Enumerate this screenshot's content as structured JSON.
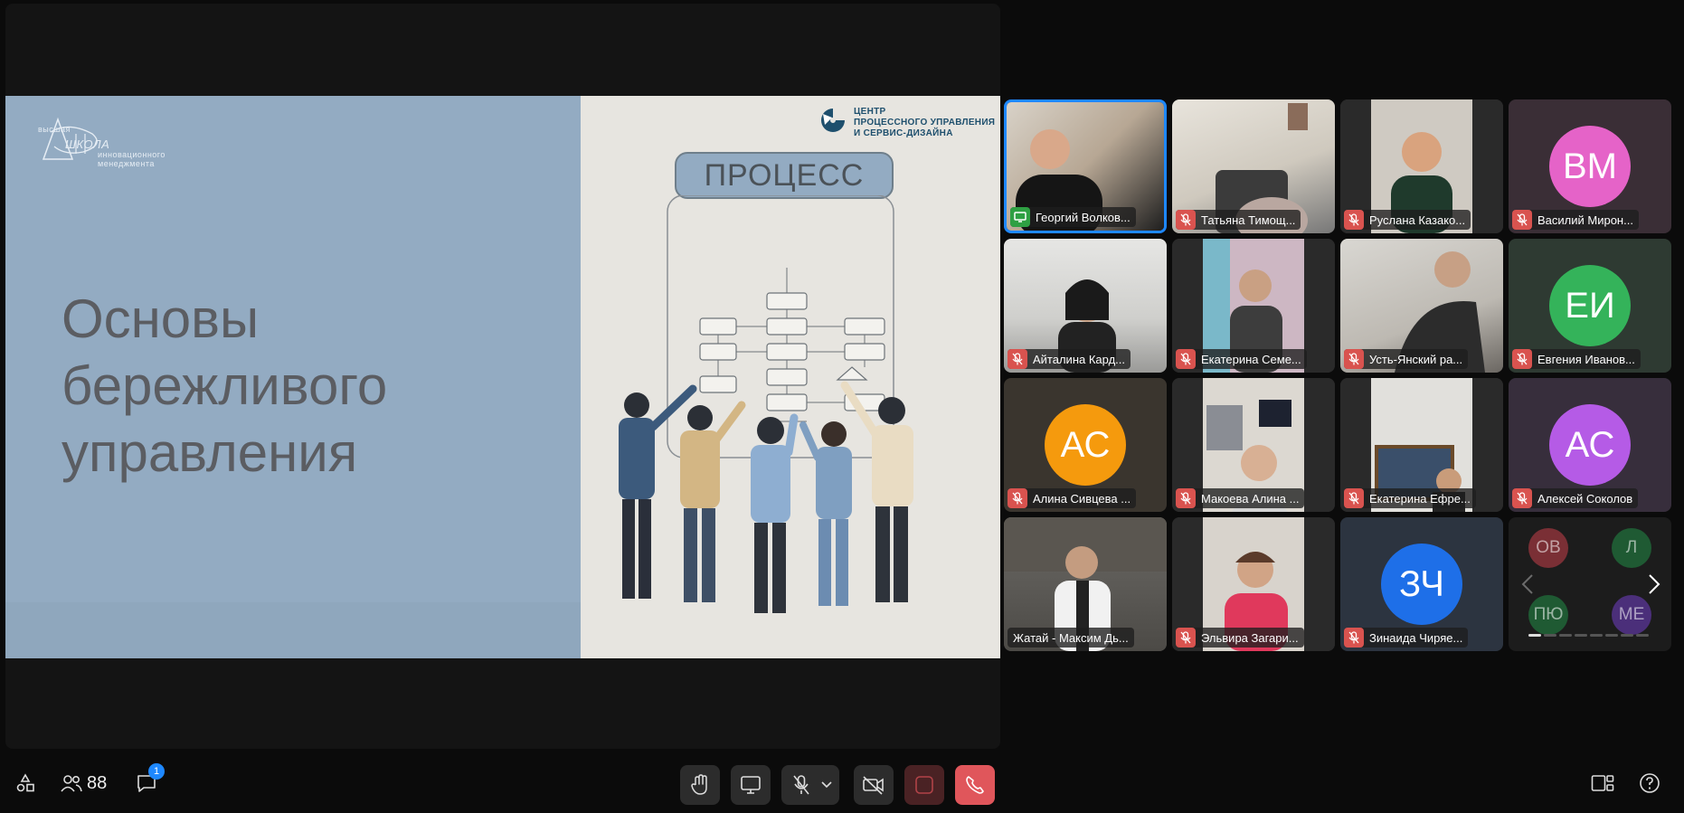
{
  "slide": {
    "title_line1": "Основы",
    "title_line2": "бережливого",
    "title_line3": "управления",
    "logo_left": {
      "line1": "высшая",
      "line2": "ШКОЛА",
      "line3": "инновационного",
      "line4": "менеджмента"
    },
    "logo_right": {
      "line1": "ЦЕНТР",
      "line2": "ПРОЦЕССНОГО УПРАВЛЕНИЯ",
      "line3": "И СЕРВИС-ДИЗАЙНА"
    },
    "process_label": "ПРОЦЕСС"
  },
  "participants": [
    {
      "name": "Георгий Волков...",
      "type": "video",
      "mic": "share",
      "active": true
    },
    {
      "name": "Татьяна Тимощ...",
      "type": "video",
      "mic": "muted"
    },
    {
      "name": "Руслана Казако...",
      "type": "video",
      "mic": "muted"
    },
    {
      "name": "Василий Мирон...",
      "type": "avatar",
      "initials": "ВМ",
      "color": "#e563c8",
      "mic": "muted"
    },
    {
      "name": "Айталина Кард...",
      "type": "video",
      "mic": "muted"
    },
    {
      "name": "Екатерина Семе...",
      "type": "video",
      "mic": "muted"
    },
    {
      "name": "Усть-Янский ра...",
      "type": "video",
      "mic": "muted"
    },
    {
      "name": "Евгения Иванов...",
      "type": "avatar",
      "initials": "ЕИ",
      "color": "#34b35a",
      "mic": "muted"
    },
    {
      "name": "Алина Сивцева ...",
      "type": "avatar",
      "initials": "АС",
      "color": "#f59a0d",
      "mic": "muted"
    },
    {
      "name": "Макоева Алина ...",
      "type": "video",
      "mic": "muted"
    },
    {
      "name": "Екатерина Ефре...",
      "type": "video",
      "mic": "muted"
    },
    {
      "name": "Алексей Соколов",
      "type": "avatar",
      "initials": "АС",
      "color": "#b55be6",
      "mic": "muted"
    },
    {
      "name": "Жатай - Максим Дь...",
      "type": "video",
      "mic": "none"
    },
    {
      "name": "Эльвира Загари...",
      "type": "video",
      "mic": "muted"
    },
    {
      "name": "Зинаида Чиряе...",
      "type": "avatar",
      "initials": "ЗЧ",
      "color": "#1e6fe8",
      "mic": "muted"
    }
  ],
  "more_tile": {
    "bubbles": [
      {
        "initials": "ОВ",
        "color": "#7a2f35"
      },
      {
        "initials": "Л",
        "color": "#1f5a33"
      },
      {
        "initials": "ПЮ",
        "color": "#1f5a33"
      },
      {
        "initials": "МЕ",
        "color": "#4b2f7a"
      }
    ]
  },
  "toolbar": {
    "participants_count": "88",
    "chat_badge": "1"
  },
  "colors": {
    "accent": "#1e88ff",
    "muted_mic": "#d9534f",
    "hangup": "#e0565b"
  }
}
